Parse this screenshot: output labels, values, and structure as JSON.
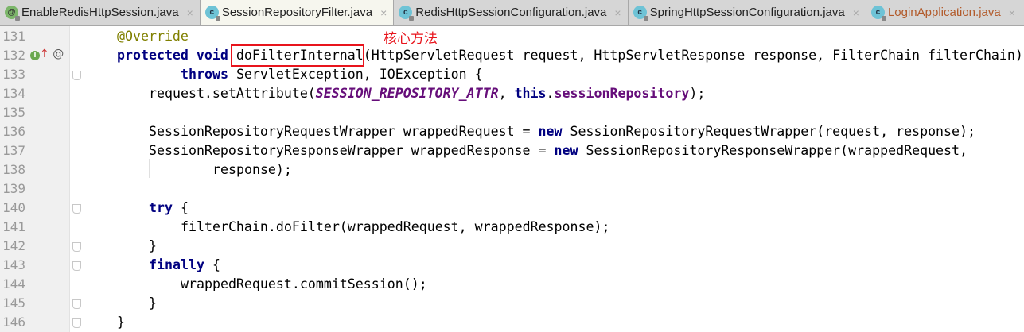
{
  "tabs": [
    {
      "label": "EnableRedisHttpSession.java",
      "icon": "@",
      "kind": "ann"
    },
    {
      "label": "SessionRepositoryFilter.java",
      "icon": "c",
      "kind": "cls",
      "active": true
    },
    {
      "label": "RedisHttpSessionConfiguration.java",
      "icon": "c",
      "kind": "cls"
    },
    {
      "label": "SpringHttpSessionConfiguration.java",
      "icon": "c",
      "kind": "cls"
    },
    {
      "label": "LoginApplication.java",
      "icon": "c",
      "kind": "cls",
      "orange": true
    }
  ],
  "close_glyph": "×",
  "annotation_note": "核心方法",
  "gutter_icons": {
    "implements": "I",
    "override_arrow": "↑",
    "at": "@"
  },
  "lines": [
    {
      "n": "131",
      "indent": 0,
      "tokens": [
        [
          "ann",
          "@Override"
        ]
      ]
    },
    {
      "n": "132",
      "indent": 0,
      "tokens": [
        [
          "kw",
          "protected void "
        ],
        [
          "",
          "doFilterInternal(HttpServletRequest request, HttpServletResponse response, FilterChain filterChain)"
        ]
      ]
    },
    {
      "n": "133",
      "indent": 8,
      "fold": true,
      "tokens": [
        [
          "kw",
          "throws "
        ],
        [
          "",
          "ServletException, IOException {"
        ]
      ]
    },
    {
      "n": "134",
      "indent": 4,
      "tokens": [
        [
          "",
          "request.setAttribute("
        ],
        [
          "sf",
          "SESSION_REPOSITORY_ATTR"
        ],
        [
          "",
          ", "
        ],
        [
          "kw",
          "this"
        ],
        [
          "",
          "."
        ],
        [
          "fld",
          "sessionRepository"
        ],
        [
          "",
          ");"
        ]
      ]
    },
    {
      "n": "135",
      "indent": 0,
      "tokens": []
    },
    {
      "n": "136",
      "indent": 4,
      "tokens": [
        [
          "",
          "SessionRepositoryRequestWrapper wrappedRequest = "
        ],
        [
          "kw",
          "new "
        ],
        [
          "",
          "SessionRepositoryRequestWrapper(request, response);"
        ]
      ]
    },
    {
      "n": "137",
      "indent": 4,
      "tokens": [
        [
          "",
          "SessionRepositoryResponseWrapper wrappedResponse = "
        ],
        [
          "kw",
          "new "
        ],
        [
          "",
          "SessionRepositoryResponseWrapper(wrappedRequest,"
        ]
      ]
    },
    {
      "n": "138",
      "indent": 12,
      "tokens": [
        [
          "",
          "response);"
        ]
      ]
    },
    {
      "n": "139",
      "indent": 0,
      "tokens": []
    },
    {
      "n": "140",
      "indent": 4,
      "fold": true,
      "tokens": [
        [
          "kw",
          "try "
        ],
        [
          "",
          "{"
        ]
      ]
    },
    {
      "n": "141",
      "indent": 8,
      "tokens": [
        [
          "",
          "filterChain.doFilter(wrappedRequest, wrappedResponse);"
        ]
      ]
    },
    {
      "n": "142",
      "indent": 4,
      "fold": true,
      "tokens": [
        [
          "",
          "}"
        ]
      ]
    },
    {
      "n": "143",
      "indent": 4,
      "fold": true,
      "tokens": [
        [
          "kw",
          "finally "
        ],
        [
          "",
          "{"
        ]
      ]
    },
    {
      "n": "144",
      "indent": 8,
      "tokens": [
        [
          "",
          "wrappedRequest.commitSession();"
        ]
      ]
    },
    {
      "n": "145",
      "indent": 4,
      "fold": true,
      "tokens": [
        [
          "",
          "}"
        ]
      ]
    },
    {
      "n": "146",
      "indent": 0,
      "fold": true,
      "tokens": [
        [
          "",
          "}"
        ]
      ]
    }
  ]
}
